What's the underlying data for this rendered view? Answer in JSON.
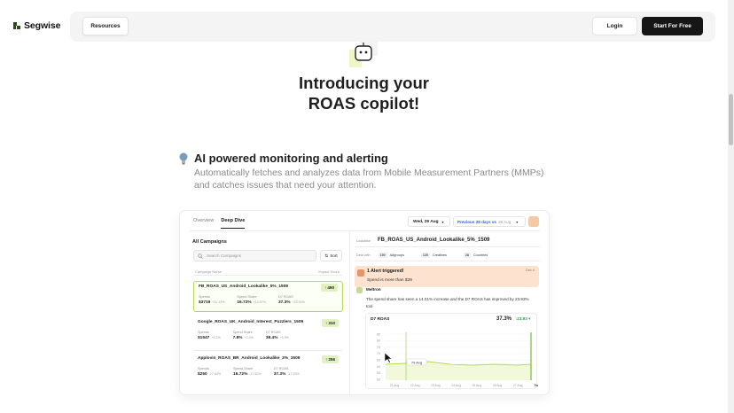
{
  "header": {
    "brand": "Segwise",
    "resources_label": "Resources",
    "login_label": "Login",
    "start_label": "Start For Free"
  },
  "hero": {
    "title_line1": "Introducing your",
    "title_line2": "ROAS copilot!"
  },
  "feature": {
    "title": "AI powered monitoring and alerting",
    "description": "Automatically fetches and analyzes data from Mobile Measurement Partners (MMPs) and catches issues that need your attention."
  },
  "dashboard": {
    "tabs": [
      "Overview",
      "Deep Dive"
    ],
    "date": "Wed, 29 Aug",
    "compare": {
      "highlight": "Previous 28 days vs",
      "muted": "28 Aug"
    },
    "left": {
      "title": "All Campaigns",
      "search_placeholder": "Search Campaigns",
      "sort_label": "Sort",
      "col_name": "Campaign Name",
      "col_score": "Impact Score",
      "metric_labels": [
        "Spends",
        "Spend Share",
        "D7 ROAS"
      ],
      "campaigns": [
        {
          "name": "FB_ROAS_US_Android_Lookalike_5%_1509",
          "score": "490",
          "spends": "$3719",
          "spends_delta": "+11.13%",
          "share": "16.72%",
          "share_delta": "+14.07%",
          "roas": "37.3%",
          "roas_delta": "+23.93%"
        },
        {
          "name": "Google_ROAS_UK_Android_Interest_Puzzlers_1509",
          "score": "310",
          "spends": "$1547",
          "spends_delta": "+4.2%",
          "share": "7.8%",
          "share_delta": "+2.4%",
          "roas": "38.4%",
          "roas_delta": "+5.9%"
        },
        {
          "name": "Applovin_ROAS_BR_Android_Lookalike_3%_1509",
          "score": "256",
          "spends": "$250",
          "spends_delta": "-17.83%",
          "share": "16.72%",
          "share_delta": "-17.62%",
          "roas": "37.3%",
          "roas_delta": "-17.63%"
        }
      ]
    },
    "right": {
      "label": "Lookalike",
      "name": "FB_ROAS_US_Android_Lookalike_5%_1509",
      "filter_label": "Deal with",
      "filters": [
        {
          "count": "190",
          "name": "Adgroups"
        },
        {
          "count": "125",
          "name": "Creatives"
        },
        {
          "count": "28",
          "name": "Countries"
        }
      ],
      "alert_title": "1 Alert triggered!",
      "alert_sub": "Spend is more than $39",
      "alert_date": "Dec 4",
      "agent": "Meltron",
      "message": "The spend share has seen a 14.01% increase and the D7 ROAS has improved by 23.93% tool",
      "chart_title": "D7 ROAS",
      "chart_value": "37.3%",
      "chart_badge": "↑23.93 ▾",
      "tooltip": "79 Avg",
      "y_ticks": [
        "85",
        "80",
        "75",
        "70",
        "65",
        "60",
        "55",
        "50"
      ],
      "x_ticks": [
        "21 Aug",
        "22 Aug",
        "23 Aug",
        "24 Aug",
        "25 Aug",
        "26 Aug",
        "27 Aug",
        "Today"
      ]
    }
  },
  "colors": {
    "accent_green": "#b4d957",
    "alert_bg": "#fde3cf",
    "brand_dark": "#161616"
  }
}
